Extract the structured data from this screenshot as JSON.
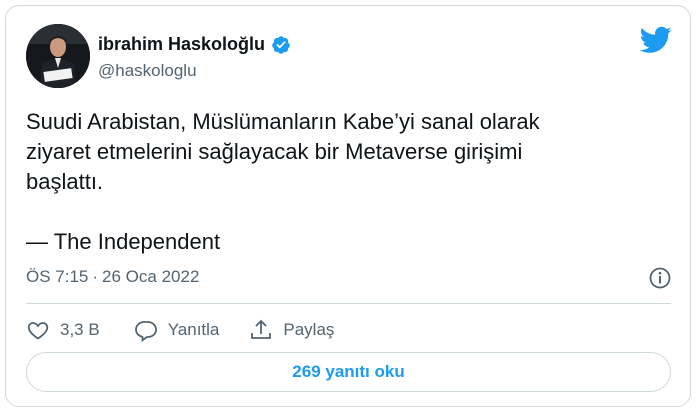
{
  "author": {
    "name": "ibrahim Haskoloğlu",
    "handle": "@haskologlu",
    "verified": true
  },
  "tweet": {
    "text": "Suudi Arabistan, Müslümanların Kabe’yi sanal olarak\nziyaret etmelerini sağlayacak bir Metaverse girişimi\nbaşlattı.\n\n— The Independent",
    "time": "ÖS 7:15",
    "separator": "·",
    "date": "26 Oca 2022"
  },
  "actions": {
    "likes": "3,3 B",
    "reply_label": "Yanıtla",
    "share_label": "Paylaş"
  },
  "replies_button": "269 yanıtı oku",
  "colors": {
    "accent": "#1d9bf0",
    "text": "#0f1419",
    "secondary": "#536471",
    "border": "#cfd9de"
  },
  "icons": [
    "verified-badge-icon",
    "twitter-bird-icon",
    "info-icon",
    "heart-icon",
    "reply-icon",
    "share-icon"
  ]
}
